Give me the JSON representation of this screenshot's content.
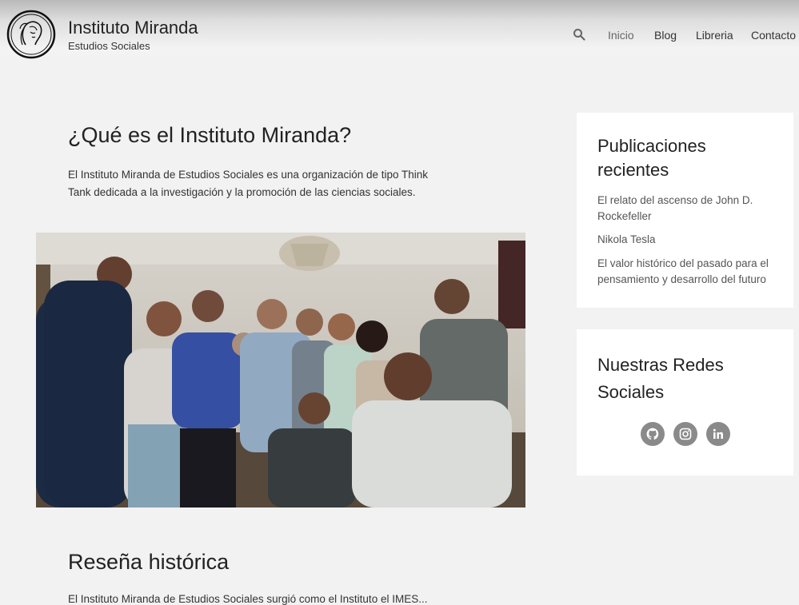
{
  "site": {
    "title": "Instituto Miranda",
    "subtitle": "Estudios Sociales"
  },
  "nav": {
    "search_icon": "search-icon",
    "items": [
      "Inicio",
      "Blog",
      "Libreria",
      "Contacto"
    ]
  },
  "main": {
    "heading": "¿Qué es el Instituto Miranda?",
    "intro": "El Instituto Miranda de Estudios Sociales es una organización de tipo Think Tank dedicada a la investigación y la promoción de las ciencias sociales.",
    "section2_heading": "Reseña histórica",
    "section2_text_cut": "El Instituto Miranda de Estudios Sociales surgió como el Instituto el IMES..."
  },
  "sidebar": {
    "recent_title": "Publicaciones recientes",
    "recent_posts": [
      "El relato del ascenso de John D. Rockefeller",
      "Nikola Tesla",
      "El valor histórico del pasado para el pensamiento y desarrollo del futuro"
    ],
    "social_title": "Nuestras Redes Sociales",
    "social_icons": [
      "github-icon",
      "instagram-icon",
      "linkedin-icon"
    ]
  },
  "colors": {
    "page_bg": "#f2f2f2",
    "widget_bg": "#ffffff",
    "social_button": "#8a8a8a"
  }
}
